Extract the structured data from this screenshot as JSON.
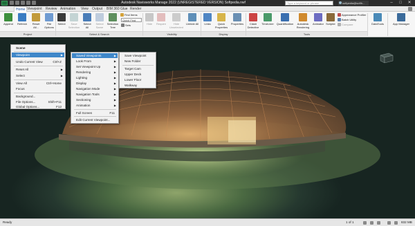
{
  "window": {
    "title": "Autodesk Navisworks Manage 2022 (UNREGISTERED VERSION)    Softpedia.nwf",
    "search_placeholder": "Type a keyword or phrase",
    "user": "softpedia@softh...",
    "controls": [
      "–",
      "□",
      "✕"
    ]
  },
  "tabs": [
    "Home",
    "Viewpoint",
    "Review",
    "Animation",
    "View",
    "Output",
    "BIM 360 Glue",
    "Render"
  ],
  "ribbon": {
    "project": {
      "buttons": [
        "Append",
        "Refresh",
        "Reset All...",
        "File Options"
      ],
      "group_label": "Project"
    },
    "select_search": {
      "buttons": [
        "Select",
        "Save Selection",
        "Select All",
        "Select Same",
        "Selection Tree"
      ],
      "find_items": "Find Items",
      "quick_find_placeholder": "Quick Find",
      "sets_label": "Sets",
      "group_label": "Select & Search"
    },
    "visibility": {
      "buttons": [
        "Hide",
        "Require",
        "Hide Unselected",
        "Unhide All"
      ],
      "group_label": "Visibility"
    },
    "display": {
      "buttons": [
        "Links",
        "Quick Properties",
        "Properties"
      ],
      "group_label": "Display"
    },
    "tools": {
      "buttons": [
        "Clash Detective",
        "TimeLiner",
        "Quantification",
        "Autodesk Rendering",
        "Animator",
        "Scripter"
      ],
      "small": [
        "Appearance Profiler",
        "Batch Utility",
        "Compare"
      ],
      "group_label": "Tools"
    },
    "extra": {
      "buttons": [
        "DataTools",
        "App Manager"
      ]
    }
  },
  "menu_main": {
    "items": [
      {
        "label": "Scene",
        "shortcut": "",
        "arrow": false
      },
      {
        "label": "Viewpoint",
        "shortcut": "",
        "arrow": true
      },
      {
        "label": "Undo Current View",
        "shortcut": "Ctrl+Z",
        "arrow": false
      },
      {
        "label": "Reset All",
        "shortcut": "",
        "arrow": true
      },
      {
        "label": "Select",
        "shortcut": "",
        "arrow": true
      },
      {
        "label": "View All",
        "shortcut": "Ctrl+Home",
        "arrow": false
      },
      {
        "label": "Focus",
        "shortcut": "",
        "arrow": false
      },
      {
        "label": "Background...",
        "shortcut": "",
        "arrow": false
      },
      {
        "label": "File Options...",
        "shortcut": "Shift+F11",
        "arrow": false
      },
      {
        "label": "Global Options...",
        "shortcut": "F12",
        "arrow": false
      }
    ]
  },
  "menu_viewpoint": {
    "items": [
      {
        "label": "Saved Viewpoints",
        "shortcut": "",
        "arrow": true
      },
      {
        "label": "Look From",
        "shortcut": "",
        "arrow": true
      },
      {
        "label": "Set Viewpoint Up",
        "shortcut": "",
        "arrow": true
      },
      {
        "label": "Rendering",
        "shortcut": "",
        "arrow": true
      },
      {
        "label": "Lighting",
        "shortcut": "",
        "arrow": true
      },
      {
        "label": "Display",
        "shortcut": "",
        "arrow": true
      },
      {
        "label": "Navigation Mode",
        "shortcut": "",
        "arrow": true
      },
      {
        "label": "Navigation Tools",
        "shortcut": "",
        "arrow": true
      },
      {
        "label": "Sectioning",
        "shortcut": "",
        "arrow": true
      },
      {
        "label": "Animation",
        "shortcut": "",
        "arrow": true
      },
      {
        "label": "Full Screen",
        "shortcut": "F11",
        "arrow": false
      },
      {
        "label": "Edit Current Viewpoint...",
        "shortcut": "",
        "arrow": false
      }
    ]
  },
  "menu_saved": {
    "items": [
      {
        "label": "Save Viewpoint"
      },
      {
        "label": "New Folder"
      },
      {
        "label": "Target Cam"
      },
      {
        "label": "Upper Deck"
      },
      {
        "label": "Lower Floor"
      },
      {
        "label": "Walkway"
      }
    ]
  },
  "status": {
    "ready": "Ready",
    "pages": "1 of 1",
    "memory": "832 MB"
  },
  "colors": {
    "accent": "#3f87c9",
    "titlebar": "#2b2b2b",
    "ribbon": "#f6f6f6"
  }
}
